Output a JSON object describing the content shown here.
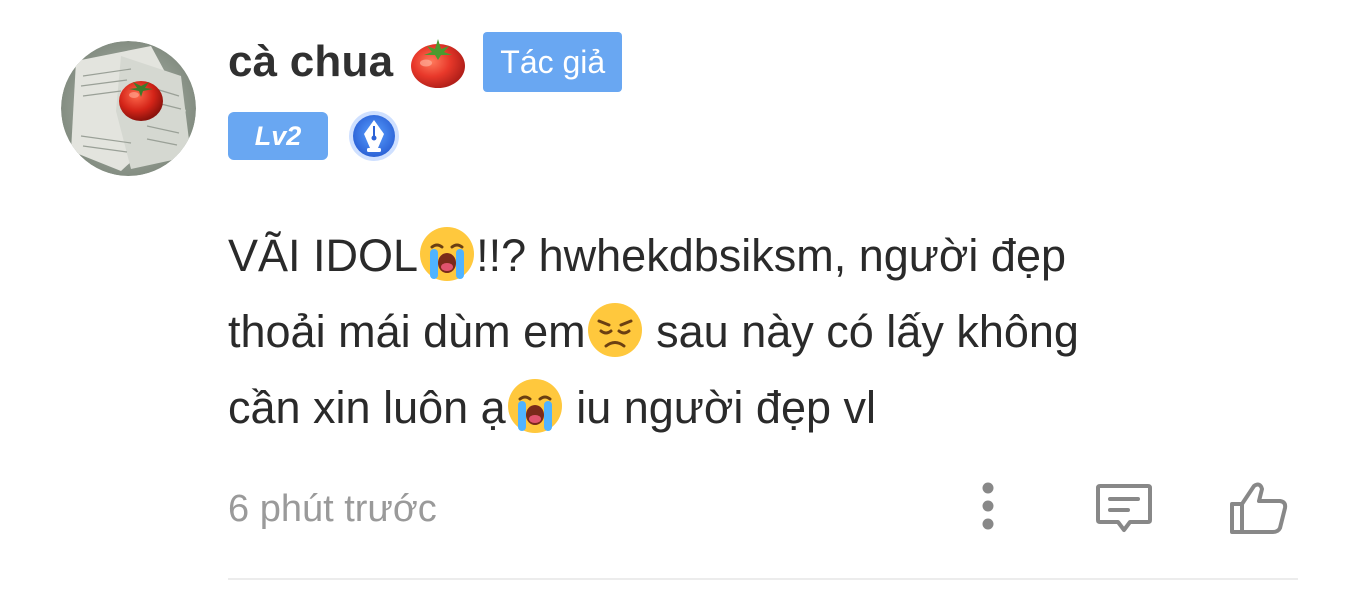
{
  "comment": {
    "author": {
      "name": "cà chua",
      "name_emoji": "tomato-emoji",
      "author_badge": "Tác giả",
      "level": "Lv2",
      "avatar": "tomato-photo-avatar",
      "special_badge": "pen-nib-badge-icon"
    },
    "content": {
      "line1_a": "VÃI IDOL",
      "line1_b": "!!? hwhekdbsiksm, người đẹp",
      "line2_a": "thoải mái dùm em",
      "line2_b": " sau này có lấy không",
      "line3_a": "cần xin luôn ạ",
      "line3_b": " iu người đẹp vl"
    },
    "timestamp": "6 phút trước",
    "actions": {
      "more": "more-vertical-icon",
      "reply": "reply-comment-icon",
      "like": "thumbs-up-icon"
    }
  },
  "colors": {
    "accent": "#69a7f2",
    "text": "#2a2a2a",
    "muted": "#9a9a9a",
    "icon": "#888888",
    "divider": "#ececec"
  }
}
